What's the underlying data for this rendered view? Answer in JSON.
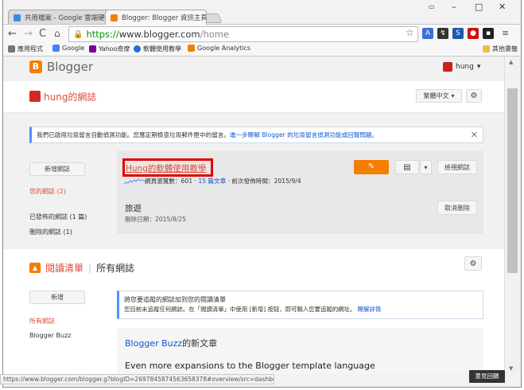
{
  "tabs": [
    {
      "label": "共用檔案 - Google 雲端硬碟"
    },
    {
      "label": "Blogger: Blogger 資訊主頁"
    }
  ],
  "address": {
    "scheme": "https://",
    "host": "www.blogger.com",
    "path": "/home"
  },
  "bookmarks": [
    "應用程式",
    "Google",
    "Yahoo奇摩",
    "軟體使用教學",
    "Google Analytics",
    "其他書籤"
  ],
  "header": {
    "brand": "Blogger",
    "user": "hung"
  },
  "blog": {
    "title": "hung的網誌",
    "lang": "繁體中文"
  },
  "notice": {
    "text": "我們已啟用垃圾留言自動偵測功能。您應定期檢查垃圾郵件匣中的留言。",
    "link": "進一步瞭解 Blogger 的垃圾留言偵測功能或回報問題。"
  },
  "sidebar": {
    "new_blog": "新增網誌",
    "your_blogs": "您的網誌 (2)",
    "deleted_blogs": "已發佈的網誌 (1 篇)",
    "removed_blogs": "刪除的網誌 (1)"
  },
  "blog_entry": {
    "name": "Hung的軟體使用教學",
    "pageviews_label": "網頁瀏覽數：601",
    "posts": "15 篇文章",
    "last_post": "前次發佈時間：2015/9/4",
    "view_blog": "檢視網誌"
  },
  "deleted_entry": {
    "name": "旅遊",
    "deleted_date": "刪除日期：2015/8/25",
    "undelete": "取消刪除"
  },
  "reading": {
    "title": "閱讀清單",
    "all": "所有網誌",
    "add": "新增",
    "all_blogs": "所有網誌",
    "blogger_buzz": "Blogger Buzz"
  },
  "callout": {
    "title": "將您要追蹤的網誌加到您的閱讀清單",
    "sub": "您目前未追蹤任何網誌。在「閱讀清單」中使用 [新增] 按鈕，即可輸入您要追蹤的網址。",
    "link": "瞭解詳情"
  },
  "feed": {
    "title_link": "Blogger Buzz",
    "title_suffix": "的新文章",
    "post": "Even more expansions to the Blogger template language"
  },
  "status_url": "https://www.blogger.com/blogger.g?blogID=2697845874563658378#overview/src=dashboard",
  "feedback": "意見回饋",
  "colors": {
    "accent": "#f57d00",
    "title_red": "#dd4b39",
    "link": "#1155cc"
  }
}
